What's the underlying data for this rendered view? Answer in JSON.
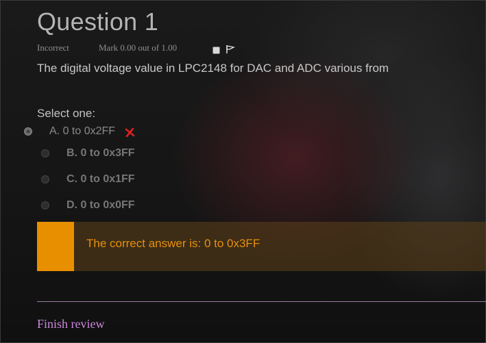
{
  "question": {
    "title": "Question 1",
    "status": "Incorrect",
    "mark": "Mark 0.00 out of 1.00",
    "text": "The digital voltage value in LPC2148 for DAC and ADC various from",
    "prompt": "Select one:",
    "options": [
      {
        "label": "A. 0 to 0x2FF",
        "selected": true,
        "result": "incorrect"
      },
      {
        "label": "B. 0 to 0x3FF",
        "selected": false
      },
      {
        "label": "C. 0 to 0x1FF",
        "selected": false
      },
      {
        "label": "D. 0 to 0x0FF",
        "selected": false
      }
    ]
  },
  "feedback": {
    "text": "The correct answer is: 0 to 0x3FF"
  },
  "footer": {
    "finish_label": "Finish review"
  },
  "icons": {
    "flag": "flag-icon",
    "wrong": "cross-icon"
  },
  "colors": {
    "feedback_accent": "#e88f00",
    "wrong_mark": "#e02020",
    "link": "#cc88dd"
  }
}
